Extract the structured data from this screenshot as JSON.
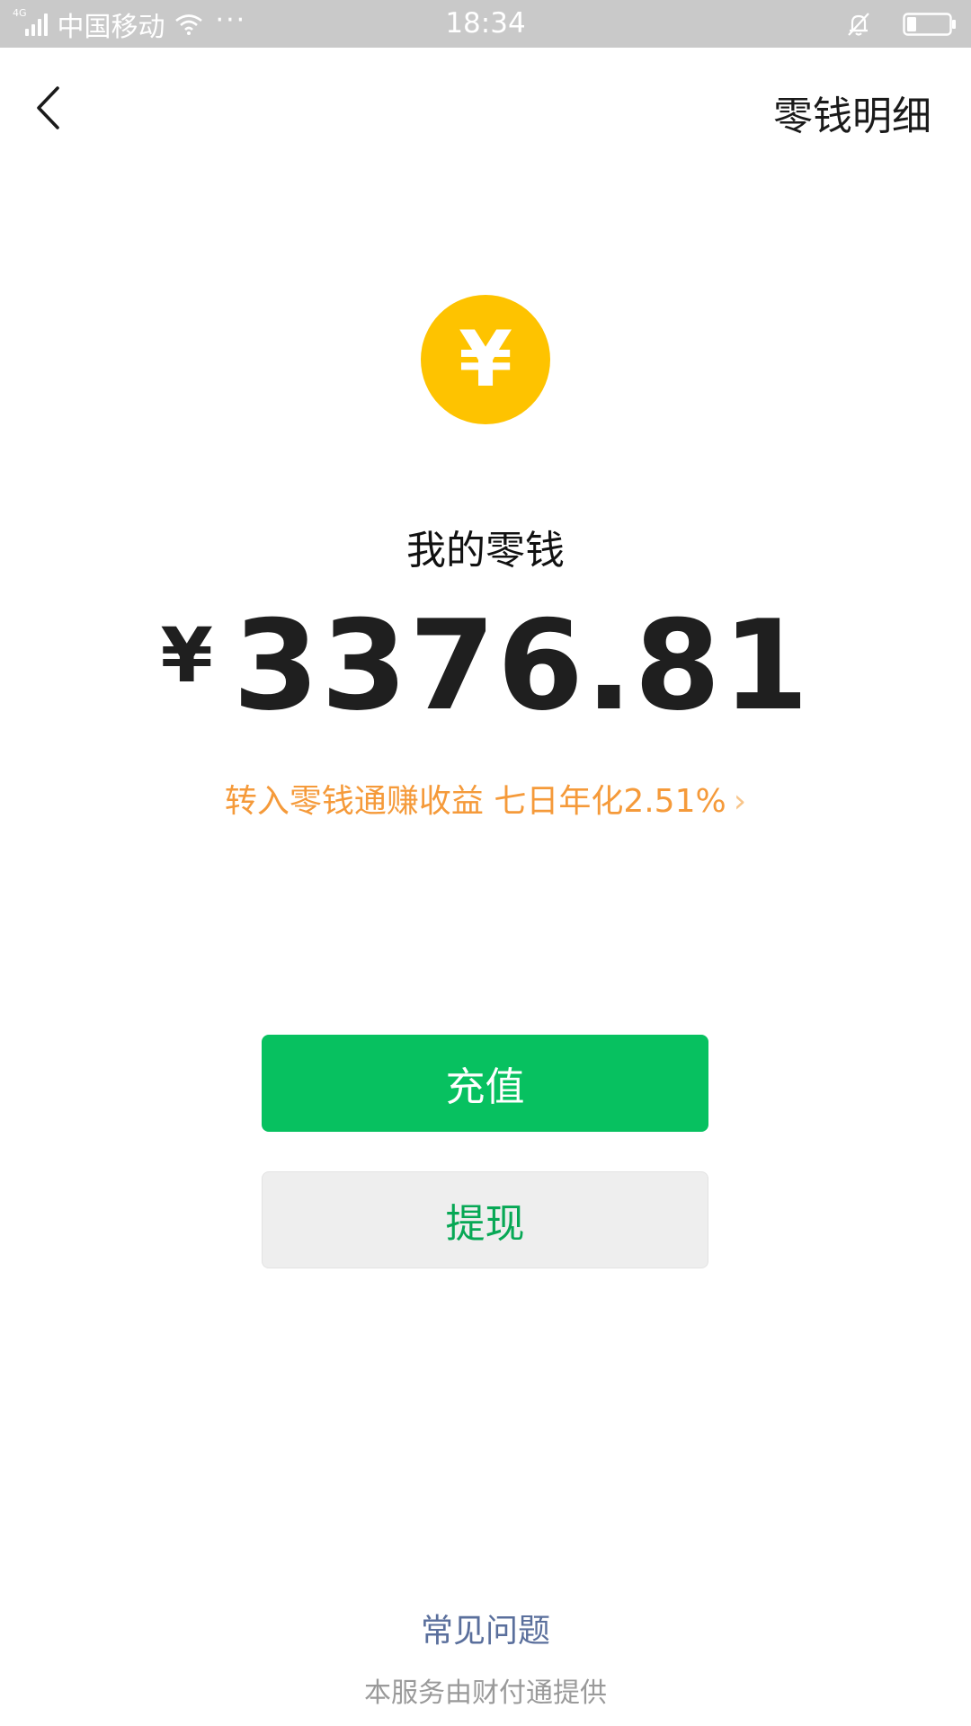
{
  "status_bar": {
    "network_type": "4G",
    "carrier": "中国移动",
    "more_indicator": "···",
    "time": "18:34",
    "icons": [
      "signal-icon",
      "wifi-icon",
      "bell-muted-icon",
      "battery-icon"
    ]
  },
  "nav": {
    "back_icon": "chevron-left-icon",
    "action_label": "零钱明细"
  },
  "balance": {
    "coin_symbol": "¥",
    "label": "我的零钱",
    "currency": "¥",
    "amount": "3376.81",
    "coin_color": "#fec300"
  },
  "promo": {
    "text": "转入零钱通赚收益 七日年化2.51%",
    "chevron": "›",
    "color": "#f59a3a"
  },
  "actions": {
    "recharge_label": "充值",
    "withdraw_label": "提现",
    "primary_color": "#07c160"
  },
  "footer": {
    "faq_label": "常见问题",
    "provider_text": "本服务由财付通提供"
  }
}
